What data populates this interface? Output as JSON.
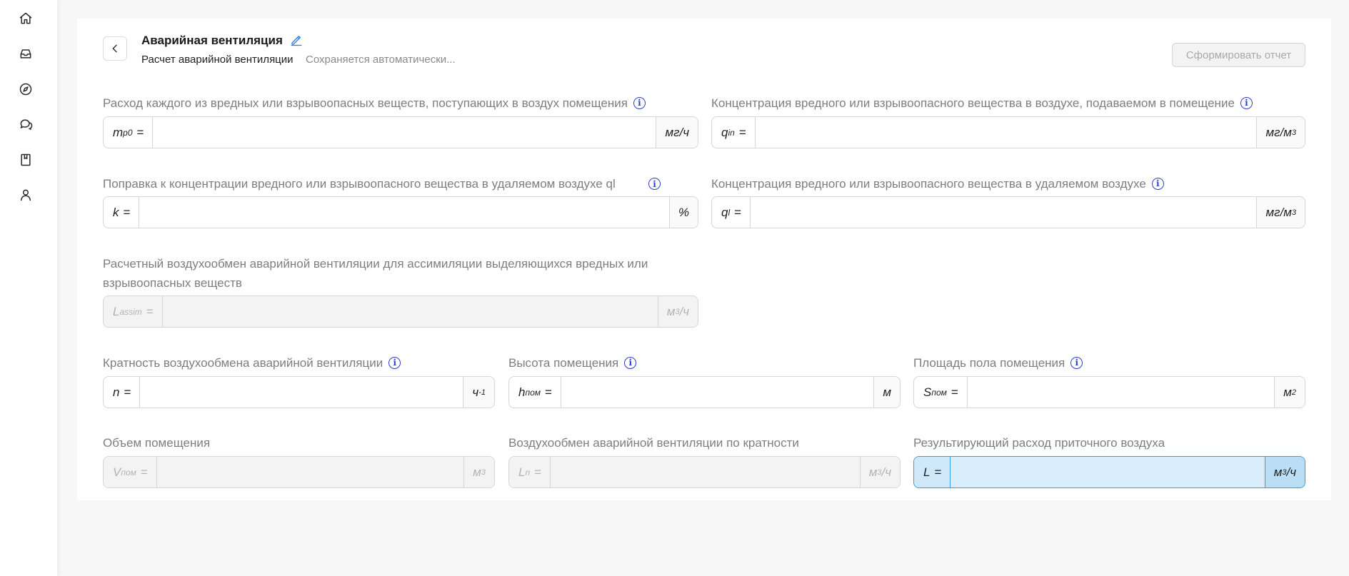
{
  "sidebar": {
    "items": [
      {
        "name": "home-icon"
      },
      {
        "name": "inbox-icon"
      },
      {
        "name": "compass-icon"
      },
      {
        "name": "chat-icon"
      },
      {
        "name": "book-icon"
      },
      {
        "name": "user-icon"
      }
    ]
  },
  "header": {
    "title": "Аварийная вентиляция",
    "subtitle": "Расчет аварийной вентиляции",
    "autosave": "Сохраняется автоматически...",
    "report_button": "Сформировать отчет"
  },
  "fields": {
    "mp0": {
      "label": "Расход каждого из вредных или взрывоопасных веществ, поступающих в воздух помещения",
      "symbol": "m",
      "sub": "p0",
      "unit": "мг/ч",
      "value": ""
    },
    "qin": {
      "label": "Концентрация вредного или взрывоопасного вещества в воздухе, подаваемом в помещение",
      "symbol": "q",
      "sub": "in",
      "unit_base": "мг/м",
      "unit_sup": "3",
      "value": ""
    },
    "k": {
      "label": "Поправка к концентрации вредного или взрывоопасного вещества в удаляемом воздухе ql",
      "symbol": "k",
      "unit": "%",
      "value": ""
    },
    "ql": {
      "label": "Концентрация вредного или взрывоопасного вещества в удаляемом воздухе",
      "symbol": "q",
      "sub": "l",
      "unit_base": "мг/м",
      "unit_sup": "3",
      "value": ""
    },
    "lassim": {
      "label": "Расчетный воздухообмен аварийной вентиляции для ассимиляции выделяющихся вредных или взрывоопасных веществ",
      "symbol": "L",
      "sub": "assim",
      "unit_base": "м",
      "unit_sup": "3",
      "unit_tail": "/ч",
      "value": ""
    },
    "n": {
      "label": "Кратность воздухообмена аварийной вентиляции",
      "symbol": "n",
      "unit_base": "ч",
      "unit_sup": "-1",
      "value": ""
    },
    "hpom": {
      "label": "Высота помещения",
      "symbol": "h",
      "sub": "пом",
      "unit": "м",
      "value": ""
    },
    "spom": {
      "label": "Площадь пола помещения",
      "symbol": "S",
      "sub": "пом",
      "unit_base": "м",
      "unit_sup": "2",
      "value": ""
    },
    "vpom": {
      "label": "Объем помещения",
      "symbol": "V",
      "sub": "пом",
      "unit_base": "м",
      "unit_sup": "3",
      "value": ""
    },
    "ln": {
      "label": "Воздухообмен аварийной вентиляции по кратности",
      "symbol": "L",
      "sub": "n",
      "unit_base": "м",
      "unit_sup": "3",
      "unit_tail": "/ч",
      "value": ""
    },
    "l": {
      "label": "Результирующий расход приточного воздуха",
      "symbol": "L",
      "unit_base": "м",
      "unit_sup": "3",
      "unit_tail": "/ч",
      "value": ""
    }
  },
  "eq": "=",
  "info_glyph": "i"
}
